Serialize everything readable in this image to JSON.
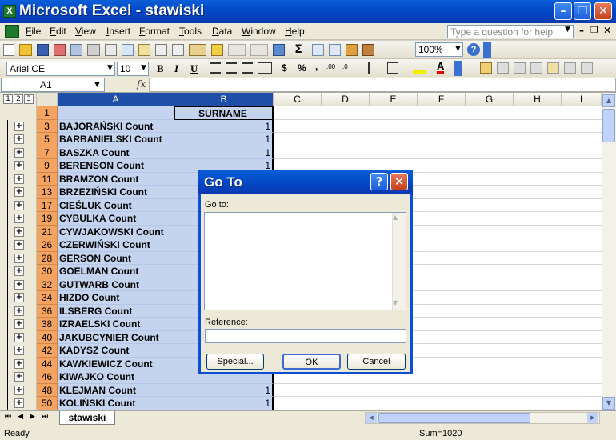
{
  "window": {
    "title": "Microsoft Excel - stawiski",
    "app_icon": "X"
  },
  "menu": {
    "items": [
      "File",
      "Edit",
      "View",
      "Insert",
      "Format",
      "Tools",
      "Data",
      "Window",
      "Help"
    ],
    "help_placeholder": "Type a question for help"
  },
  "toolbar": {
    "zoom": "100%",
    "font_name": "Arial CE",
    "font_size": "10"
  },
  "formula_bar": {
    "name_box": "A1",
    "fx": "fx",
    "value": ""
  },
  "outline": {
    "levels": [
      "1",
      "2",
      "3"
    ],
    "plus": "+"
  },
  "columns": [
    "A",
    "B",
    "C",
    "D",
    "E",
    "F",
    "G",
    "H",
    "I"
  ],
  "rows": [
    {
      "num": "1",
      "a": "",
      "b": "SURNAME"
    },
    {
      "num": "3",
      "a": "BAJORAŃSKI Count",
      "b": "1"
    },
    {
      "num": "5",
      "a": "BARBANIELSKI Count",
      "b": "1"
    },
    {
      "num": "7",
      "a": "BASZKA Count",
      "b": "1"
    },
    {
      "num": "9",
      "a": "BERENSON Count",
      "b": "1"
    },
    {
      "num": "11",
      "a": "BRAMZON Count",
      "b": ""
    },
    {
      "num": "13",
      "a": "BRZEZIŃSKI Count",
      "b": ""
    },
    {
      "num": "17",
      "a": "CIEŚLUK Count",
      "b": ""
    },
    {
      "num": "19",
      "a": "CYBULKA Count",
      "b": ""
    },
    {
      "num": "21",
      "a": "CYWJAKOWSKI Count",
      "b": ""
    },
    {
      "num": "26",
      "a": "CZERWIŃSKI Count",
      "b": ""
    },
    {
      "num": "28",
      "a": "GERSON Count",
      "b": ""
    },
    {
      "num": "30",
      "a": "GOELMAN Count",
      "b": ""
    },
    {
      "num": "32",
      "a": "GUTWARB Count",
      "b": ""
    },
    {
      "num": "34",
      "a": "HIZDO Count",
      "b": ""
    },
    {
      "num": "36",
      "a": "ILSBERG Count",
      "b": ""
    },
    {
      "num": "38",
      "a": "IZRAELSKI Count",
      "b": ""
    },
    {
      "num": "40",
      "a": "JAKUBCYNIER Count",
      "b": ""
    },
    {
      "num": "42",
      "a": "KADYSZ Count",
      "b": ""
    },
    {
      "num": "44",
      "a": "KAWKIEWICZ Count",
      "b": ""
    },
    {
      "num": "46",
      "a": "KIWAJKO Count",
      "b": ""
    },
    {
      "num": "48",
      "a": "KLEJMAN Count",
      "b": "1"
    },
    {
      "num": "50",
      "a": "KOLIŃSKI Count",
      "b": "1"
    }
  ],
  "sheet_tab": "stawiski",
  "status": {
    "left": "Ready",
    "sum": "Sum=1020"
  },
  "dialog": {
    "title": "Go To",
    "goto_label": "Go to:",
    "reference_label": "Reference:",
    "special_button": "Special...",
    "ok_button": "OK",
    "cancel_button": "Cancel"
  }
}
